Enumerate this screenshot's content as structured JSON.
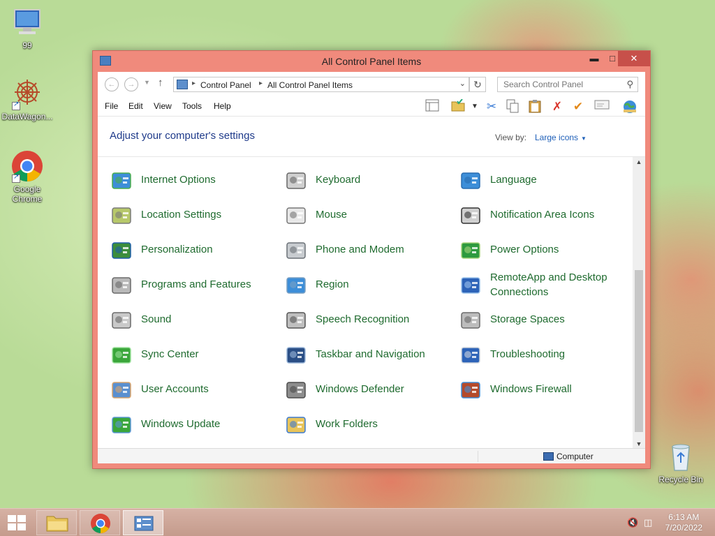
{
  "desktop": {
    "icons": [
      {
        "label": "99",
        "icon": "computer-icon"
      },
      {
        "label": "DataWagon...",
        "icon": "datawagon-icon"
      },
      {
        "label": "Google Chrome",
        "icon": "chrome-icon"
      },
      {
        "label": "Recycle Bin",
        "icon": "recycle-bin-icon"
      }
    ]
  },
  "window": {
    "title": "All Control Panel Items",
    "address": {
      "crumbs": [
        "Control Panel",
        "All Control Panel Items"
      ],
      "search_placeholder": "Search Control Panel"
    },
    "menu": [
      "File",
      "Edit",
      "View",
      "Tools",
      "Help"
    ],
    "toolbar_icons": [
      "layout-icon",
      "folder-check-icon",
      "cut-icon",
      "copy-icon",
      "paste-icon",
      "delete-icon",
      "checkmark-icon",
      "email-icon",
      "globe-icon"
    ],
    "heading": "Adjust your computer's settings",
    "view_by_label": "View by:",
    "view_by_value": "Large icons",
    "items": [
      {
        "label": "Internet Options",
        "icon": "internet-options-icon"
      },
      {
        "label": "Keyboard",
        "icon": "keyboard-icon"
      },
      {
        "label": "Language",
        "icon": "language-icon"
      },
      {
        "label": "Location Settings",
        "icon": "location-settings-icon"
      },
      {
        "label": "Mouse",
        "icon": "mouse-icon"
      },
      {
        "label": "Notification Area Icons",
        "icon": "notification-area-icon"
      },
      {
        "label": "Personalization",
        "icon": "personalization-icon"
      },
      {
        "label": "Phone and Modem",
        "icon": "phone-modem-icon"
      },
      {
        "label": "Power Options",
        "icon": "power-options-icon"
      },
      {
        "label": "Programs and Features",
        "icon": "programs-features-icon"
      },
      {
        "label": "Region",
        "icon": "region-icon"
      },
      {
        "label": "RemoteApp and Desktop Connections",
        "icon": "remoteapp-icon"
      },
      {
        "label": "Sound",
        "icon": "sound-icon"
      },
      {
        "label": "Speech Recognition",
        "icon": "speech-recognition-icon"
      },
      {
        "label": "Storage Spaces",
        "icon": "storage-spaces-icon"
      },
      {
        "label": "Sync Center",
        "icon": "sync-center-icon"
      },
      {
        "label": "Taskbar and Navigation",
        "icon": "taskbar-navigation-icon"
      },
      {
        "label": "Troubleshooting",
        "icon": "troubleshooting-icon"
      },
      {
        "label": "User Accounts",
        "icon": "user-accounts-icon"
      },
      {
        "label": "Windows Defender",
        "icon": "windows-defender-icon"
      },
      {
        "label": "Windows Firewall",
        "icon": "windows-firewall-icon"
      },
      {
        "label": "Windows Update",
        "icon": "windows-update-icon"
      },
      {
        "label": "Work Folders",
        "icon": "work-folders-icon"
      }
    ],
    "status": {
      "location": "Computer"
    }
  },
  "taskbar": {
    "apps": [
      "file-explorer-icon",
      "chrome-icon",
      "control-panel-icon"
    ],
    "time": "6:13 AM",
    "date": "7/20/2022"
  },
  "colors": {
    "window_frame": "#f08a7c",
    "item_text": "#1f6b2f",
    "heading_text": "#1e3a8a",
    "link_blue": "#1e5fb8"
  }
}
